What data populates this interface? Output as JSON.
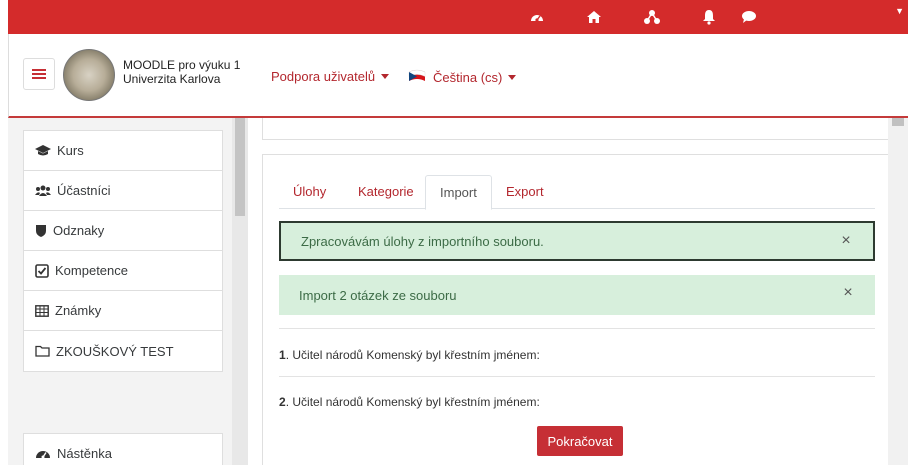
{
  "header": {
    "site_name_line1": "MOODLE pro výuku 1",
    "site_name_line2": "Univerzita Karlova",
    "support_link": "Podpora uživatelů",
    "language_link": "Čeština (cs)"
  },
  "topbar": {
    "icons": [
      "dashboard-icon",
      "home-icon",
      "sitemap-icon",
      "bell-icon",
      "chat-icon"
    ]
  },
  "sidebar": {
    "items": [
      {
        "label": "Kurs",
        "icon": "graduation-cap-icon"
      },
      {
        "label": "Účastníci",
        "icon": "users-icon"
      },
      {
        "label": "Odznaky",
        "icon": "shield-icon"
      },
      {
        "label": "Kompetence",
        "icon": "checkbox-icon"
      },
      {
        "label": "Známky",
        "icon": "table-icon"
      },
      {
        "label": "ZKOUŠKOVÝ TEST",
        "icon": "folder-icon"
      }
    ],
    "dashboard": {
      "label": "Nástěnka",
      "icon": "dashboard-icon"
    }
  },
  "main": {
    "tabs": [
      {
        "label": "Úlohy",
        "active": false
      },
      {
        "label": "Kategorie",
        "active": false
      },
      {
        "label": "Import",
        "active": true
      },
      {
        "label": "Export",
        "active": false
      }
    ],
    "alerts": [
      {
        "text": "Zpracovávám úlohy z importního souboru."
      },
      {
        "text": "Import 2 otázek ze souboru"
      }
    ],
    "questions": [
      {
        "number": "1",
        "text": ". Učitel národů Komenský byl křestním jménem:"
      },
      {
        "number": "2",
        "text": ". Učitel národů Komenský byl křestním jménem:"
      }
    ],
    "continue_button": "Pokračovat",
    "close_symbol": "×"
  },
  "colors": {
    "brand_red": "#d42b2b",
    "link_red": "#b3272e",
    "success_bg": "#d7efdc",
    "button_red": "#c62f35"
  }
}
